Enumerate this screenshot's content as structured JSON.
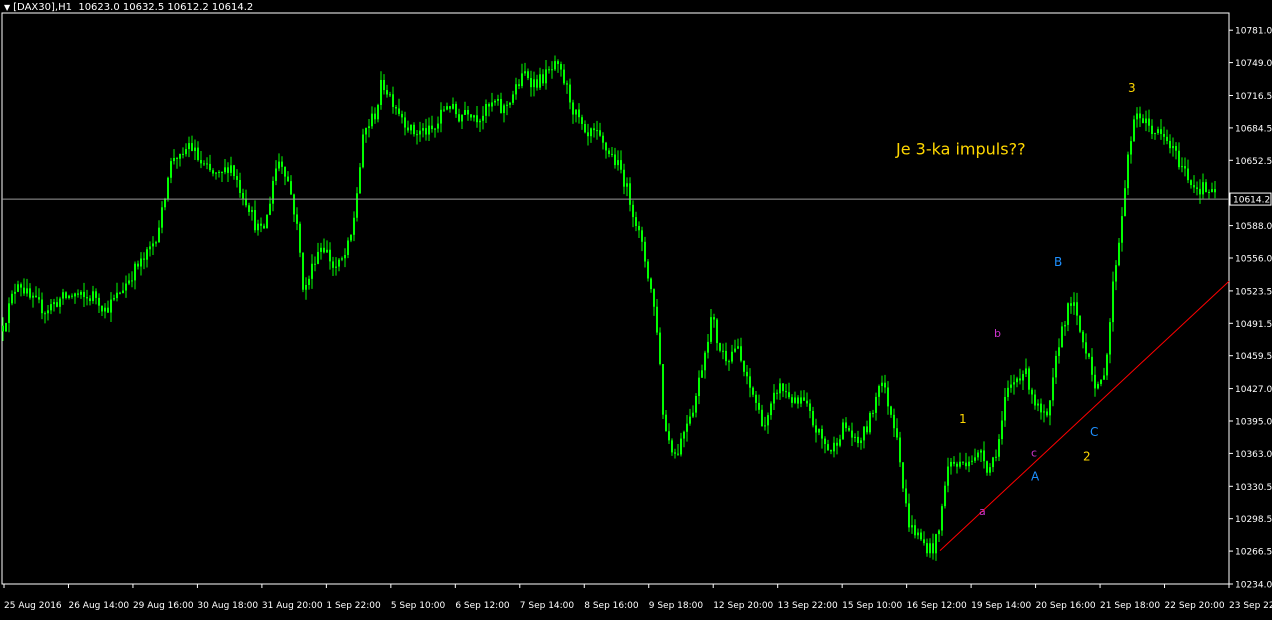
{
  "header": {
    "menu_glyph": "▼",
    "symbol": "[DAX30],H1",
    "ohlc": "10623.0 10632.5 10612.2 10614.2"
  },
  "colors": {
    "background": "#000000",
    "candle": "#00ff00",
    "axis": "#ffffff",
    "trendline": "#ff0000",
    "annotation_yellow": "#ffd700",
    "label_blue": "#1e90ff",
    "label_magenta": "#cc33cc"
  },
  "chart_data": {
    "type": "candlestick",
    "title": "",
    "xlabel": "",
    "ylabel": "",
    "ylim": [
      10234,
      10797
    ],
    "yticks": [
      "10781.0",
      "10749.0",
      "10716.5",
      "10684.5",
      "10652.5",
      "10588.0",
      "10556.0",
      "10523.5",
      "10491.5",
      "10459.5",
      "10427.0",
      "10395.0",
      "10363.0",
      "10330.5",
      "10298.5",
      "10266.5",
      "10234.0"
    ],
    "current_price": "10614.2",
    "xticks": [
      "25 Aug 2016",
      "26 Aug 14:00",
      "29 Aug 16:00",
      "30 Aug 18:00",
      "31 Aug 20:00",
      "1 Sep 22:00",
      "5 Sep 10:00",
      "6 Sep 12:00",
      "7 Sep 14:00",
      "8 Sep 16:00",
      "9 Sep 18:00",
      "12 Sep 20:00",
      "13 Sep 22:00",
      "15 Sep 10:00",
      "16 Sep 12:00",
      "19 Sep 14:00",
      "20 Sep 16:00",
      "21 Sep 18:00",
      "22 Sep 20:00",
      "23 Sep 22:00"
    ],
    "grid": false,
    "path_points": [
      [
        0,
        10480
      ],
      [
        18,
        10535
      ],
      [
        30,
        10515
      ],
      [
        45,
        10505
      ],
      [
        60,
        10515
      ],
      [
        75,
        10520
      ],
      [
        85,
        10515
      ],
      [
        95,
        10520
      ],
      [
        105,
        10505
      ],
      [
        115,
        10515
      ],
      [
        125,
        10530
      ],
      [
        135,
        10545
      ],
      [
        145,
        10555
      ],
      [
        155,
        10575
      ],
      [
        162,
        10600
      ],
      [
        168,
        10640
      ],
      [
        175,
        10660
      ],
      [
        182,
        10650
      ],
      [
        188,
        10670
      ],
      [
        195,
        10660
      ],
      [
        200,
        10650
      ],
      [
        210,
        10640
      ],
      [
        220,
        10635
      ],
      [
        230,
        10650
      ],
      [
        240,
        10625
      ],
      [
        248,
        10610
      ],
      [
        255,
        10590
      ],
      [
        262,
        10580
      ],
      [
        268,
        10600
      ],
      [
        274,
        10640
      ],
      [
        280,
        10655
      ],
      [
        286,
        10640
      ],
      [
        292,
        10615
      ],
      [
        298,
        10580
      ],
      [
        304,
        10520
      ],
      [
        310,
        10540
      ],
      [
        316,
        10560
      ],
      [
        322,
        10570
      ],
      [
        328,
        10560
      ],
      [
        334,
        10545
      ],
      [
        340,
        10550
      ],
      [
        346,
        10560
      ],
      [
        352,
        10580
      ],
      [
        358,
        10630
      ],
      [
        364,
        10680
      ],
      [
        370,
        10690
      ],
      [
        376,
        10700
      ],
      [
        382,
        10730
      ],
      [
        388,
        10720
      ],
      [
        394,
        10710
      ],
      [
        400,
        10700
      ],
      [
        406,
        10690
      ],
      [
        412,
        10680
      ],
      [
        418,
        10680
      ],
      [
        424,
        10682
      ],
      [
        430,
        10680
      ],
      [
        436,
        10684
      ],
      [
        442,
        10700
      ],
      [
        448,
        10710
      ],
      [
        454,
        10700
      ],
      [
        460,
        10695
      ],
      [
        466,
        10705
      ],
      [
        472,
        10700
      ],
      [
        478,
        10695
      ],
      [
        484,
        10700
      ],
      [
        490,
        10705
      ],
      [
        496,
        10710
      ],
      [
        502,
        10700
      ],
      [
        508,
        10710
      ],
      [
        514,
        10720
      ],
      [
        520,
        10730
      ],
      [
        526,
        10740
      ],
      [
        532,
        10730
      ],
      [
        538,
        10730
      ],
      [
        544,
        10735
      ],
      [
        550,
        10740
      ],
      [
        556,
        10745
      ],
      [
        562,
        10735
      ],
      [
        568,
        10720
      ],
      [
        574,
        10700
      ],
      [
        580,
        10690
      ],
      [
        586,
        10670
      ],
      [
        592,
        10680
      ],
      [
        598,
        10675
      ],
      [
        604,
        10665
      ],
      [
        610,
        10660
      ],
      [
        616,
        10650
      ],
      [
        622,
        10640
      ],
      [
        628,
        10620
      ],
      [
        634,
        10600
      ],
      [
        640,
        10575
      ],
      [
        646,
        10550
      ],
      [
        652,
        10520
      ],
      [
        658,
        10480
      ],
      [
        664,
        10390
      ],
      [
        670,
        10375
      ],
      [
        676,
        10360
      ],
      [
        682,
        10380
      ],
      [
        688,
        10400
      ],
      [
        694,
        10410
      ],
      [
        700,
        10440
      ],
      [
        706,
        10470
      ],
      [
        712,
        10500
      ],
      [
        718,
        10470
      ],
      [
        724,
        10460
      ],
      [
        730,
        10460
      ],
      [
        736,
        10470
      ],
      [
        742,
        10450
      ],
      [
        748,
        10430
      ],
      [
        754,
        10420
      ],
      [
        760,
        10400
      ],
      [
        766,
        10390
      ],
      [
        772,
        10410
      ],
      [
        778,
        10430
      ],
      [
        784,
        10425
      ],
      [
        790,
        10420
      ],
      [
        796,
        10410
      ],
      [
        802,
        10415
      ],
      [
        808,
        10405
      ],
      [
        814,
        10390
      ],
      [
        820,
        10380
      ],
      [
        826,
        10370
      ],
      [
        832,
        10365
      ],
      [
        838,
        10380
      ],
      [
        844,
        10390
      ],
      [
        850,
        10385
      ],
      [
        856,
        10370
      ],
      [
        862,
        10380
      ],
      [
        868,
        10390
      ],
      [
        874,
        10410
      ],
      [
        880,
        10440
      ],
      [
        886,
        10420
      ],
      [
        892,
        10400
      ],
      [
        898,
        10380
      ],
      [
        904,
        10320
      ],
      [
        910,
        10290
      ],
      [
        916,
        10285
      ],
      [
        922,
        10275
      ],
      [
        928,
        10270
      ],
      [
        934,
        10270
      ],
      [
        940,
        10290
      ],
      [
        946,
        10345
      ],
      [
        952,
        10355
      ],
      [
        958,
        10350
      ],
      [
        964,
        10355
      ],
      [
        970,
        10360
      ],
      [
        976,
        10355
      ],
      [
        982,
        10370
      ],
      [
        988,
        10345
      ],
      [
        994,
        10360
      ],
      [
        1000,
        10380
      ],
      [
        1006,
        10420
      ],
      [
        1012,
        10430
      ],
      [
        1018,
        10440
      ],
      [
        1024,
        10445
      ],
      [
        1030,
        10430
      ],
      [
        1036,
        10410
      ],
      [
        1042,
        10400
      ],
      [
        1048,
        10395
      ],
      [
        1054,
        10440
      ],
      [
        1060,
        10480
      ],
      [
        1066,
        10500
      ],
      [
        1072,
        10515
      ],
      [
        1078,
        10490
      ],
      [
        1084,
        10470
      ],
      [
        1090,
        10460
      ],
      [
        1096,
        10420
      ],
      [
        1102,
        10435
      ],
      [
        1108,
        10470
      ],
      [
        1114,
        10540
      ],
      [
        1120,
        10580
      ],
      [
        1126,
        10640
      ],
      [
        1132,
        10680
      ],
      [
        1138,
        10700
      ],
      [
        1144,
        10690
      ],
      [
        1150,
        10685
      ],
      [
        1156,
        10680
      ],
      [
        1162,
        10675
      ],
      [
        1168,
        10670
      ],
      [
        1174,
        10660
      ],
      [
        1180,
        10650
      ],
      [
        1186,
        10640
      ],
      [
        1192,
        10630
      ],
      [
        1198,
        10625
      ],
      [
        1204,
        10625
      ],
      [
        1210,
        10620
      ],
      [
        1216,
        10615
      ]
    ],
    "trendline": {
      "from": [
        940,
        10267
      ],
      "to": [
        1229,
        10533
      ]
    },
    "annotations": [
      {
        "text": "Je 3-ka impuls??",
        "x": 896,
        "price": 10658,
        "color": "yellow",
        "size": 16
      },
      {
        "text": "3",
        "x": 1128,
        "price": 10720,
        "color": "yellow",
        "size": 12
      },
      {
        "text": "B",
        "x": 1054,
        "price": 10548,
        "color": "blue",
        "size": 12
      },
      {
        "text": "b",
        "x": 994,
        "price": 10478,
        "color": "magenta",
        "size": 11
      },
      {
        "text": "1",
        "x": 959,
        "price": 10393,
        "color": "yellow",
        "size": 12
      },
      {
        "text": "C",
        "x": 1090,
        "price": 10380,
        "color": "blue",
        "size": 12
      },
      {
        "text": "c",
        "x": 1031,
        "price": 10360,
        "color": "magenta",
        "size": 11
      },
      {
        "text": "2",
        "x": 1083,
        "price": 10356,
        "color": "yellow",
        "size": 12
      },
      {
        "text": "A",
        "x": 1031,
        "price": 10336,
        "color": "blue",
        "size": 12
      },
      {
        "text": "a",
        "x": 979,
        "price": 10302,
        "color": "magenta",
        "size": 11
      }
    ]
  }
}
